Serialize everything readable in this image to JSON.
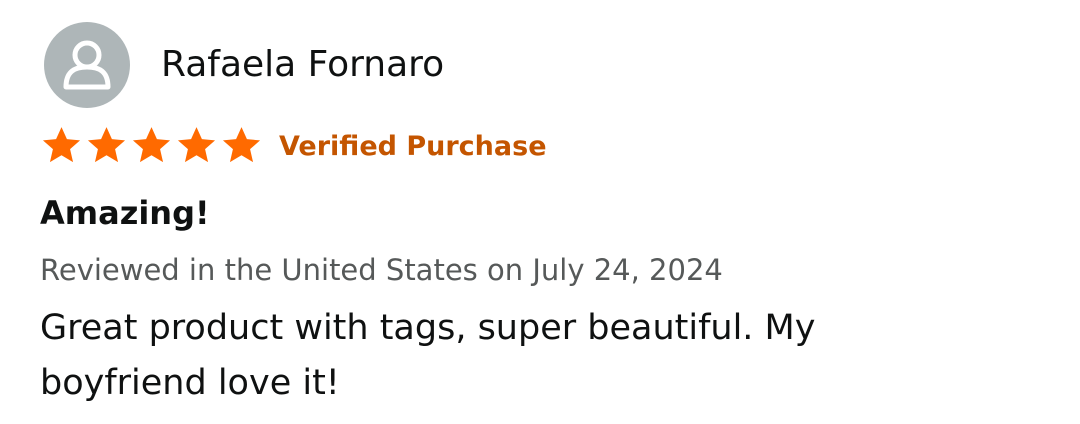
{
  "reviewer": {
    "name": "Rafaela Fornaro",
    "avatar_icon": "default-user-icon",
    "avatar_bg": "#aeb6b8"
  },
  "rating": {
    "value": 5,
    "max": 5,
    "star_color": "#ff6a00",
    "star_icon": "star-icon"
  },
  "verified_label": "Verified Purchase",
  "verified_color": "#c45500",
  "review": {
    "title": "Amazing!",
    "date_line": "Reviewed in the United States on July 24, 2024",
    "body": "Great product with tags, super beautiful. My boyfriend love it!"
  }
}
